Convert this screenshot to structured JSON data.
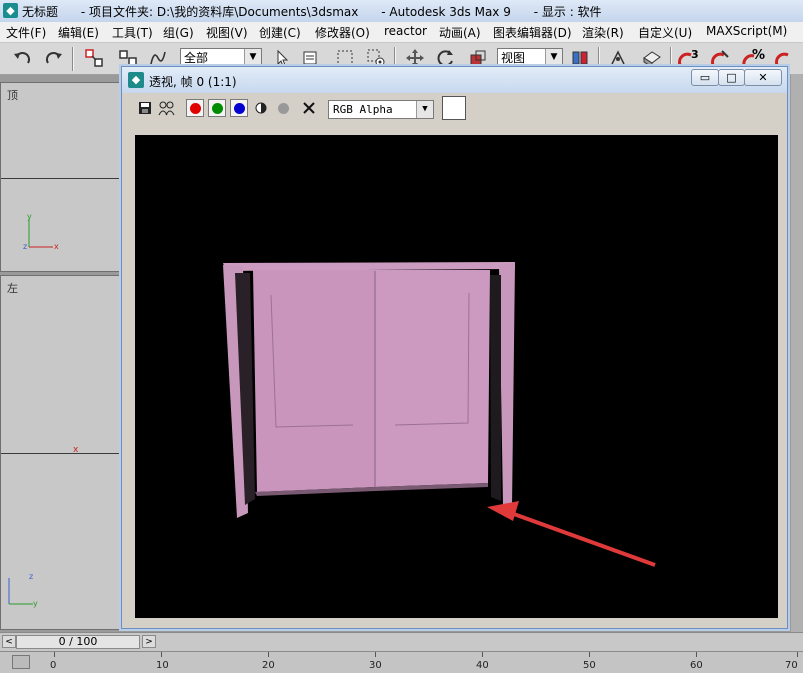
{
  "titlebar": {
    "app_icon": "3ds-max-icon",
    "title": "无标题      - 项目文件夹: D:\\我的资料库\\Documents\\3dsmax      - Autodesk 3ds Max 9      - 显示 : 软件"
  },
  "menubar": {
    "items": [
      "文件(F)",
      "编辑(E)",
      "工具(T)",
      "组(G)",
      "视图(V)",
      "创建(C)",
      "修改器(O)",
      "reactor",
      "动画(A)",
      "图表编辑器(D)",
      "渲染(R)",
      "自定义(U)",
      "MAXScript(M)"
    ]
  },
  "toolbar": {
    "selection_filter": "全部",
    "reference_coord": "视图",
    "icons": [
      "undo-icon",
      "redo-icon",
      "select-link-icon",
      "unlink-icon",
      "bind-space-warp-icon",
      "select-pointer-icon",
      "select-region-icon",
      "window-crossing-icon",
      "move-icon",
      "rotate-icon",
      "scale-icon",
      "use-pivot-icon",
      "mirror-icon",
      "align-icon",
      "angle-snap-icon",
      "percent-snap-icon",
      "spinner-snap-icon"
    ],
    "snap_label": "3",
    "percent_label": "%"
  },
  "viewports": {
    "top_label": "顶",
    "left_label": "左",
    "axis_x": "x",
    "axis_y": "y",
    "axis_z": "z"
  },
  "render_window": {
    "title": "透视, 帧 0 (1:1)",
    "minimize": "▭",
    "maximize": "□",
    "close": "✕",
    "channel": "RGB Alpha",
    "tools": [
      "save-icon",
      "clone-icon",
      "red-channel-icon",
      "green-channel-icon",
      "blue-channel-icon",
      "mono-icon",
      "alpha-icon",
      "clear-icon"
    ],
    "colors": {
      "red": "#e00000",
      "green": "#008c00",
      "blue": "#0000d0",
      "object": "#cc9bc0",
      "arrow": "#e0393a"
    }
  },
  "timeslider": {
    "frame_display": "0 / 100",
    "prev": "<",
    "next": ">"
  },
  "trackbar": {
    "ticks": [
      "0",
      "10",
      "20",
      "30",
      "40",
      "50",
      "60",
      "70"
    ]
  }
}
